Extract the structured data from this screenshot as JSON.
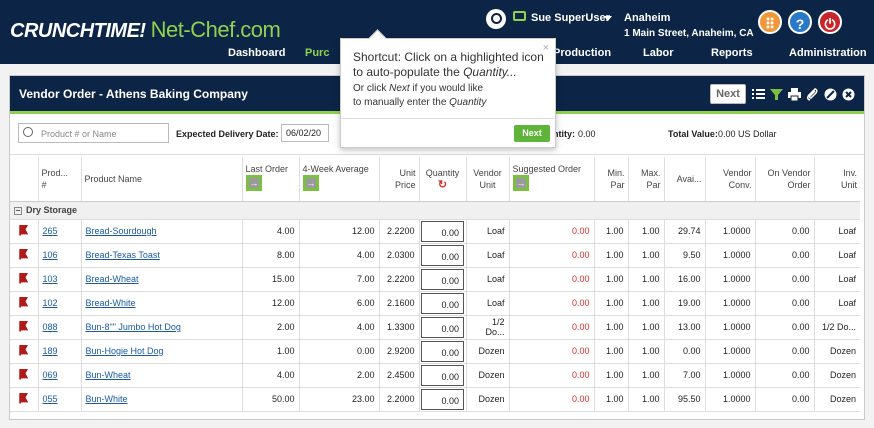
{
  "brand": {
    "part1": "CRUNCHTIME!",
    "part2": "Net-Chef.com"
  },
  "user": {
    "name": "Sue SuperUser"
  },
  "store": {
    "name": "Anaheim",
    "address": "1 Main Street, Anaheim, CA"
  },
  "nav": [
    {
      "label": "Dashboard"
    },
    {
      "label": "Purc"
    },
    {
      "label": "Production"
    },
    {
      "label": "Labor"
    },
    {
      "label": "Reports"
    },
    {
      "label": "Administration"
    }
  ],
  "panel": {
    "title": "Vendor Order - Athens Baking Company",
    "next_label": "Next"
  },
  "filters": {
    "search_placeholder": "Product # or Name",
    "delivery_label": "Expected Delivery Date:",
    "delivery_value": "06/02/20",
    "quantity_label": "antity:",
    "quantity_value": "0.00",
    "total_label": "Total Value:",
    "total_value": "0.00 US Dollar"
  },
  "tooltip": {
    "line1": "Shortcut: Click on a highlighted icon",
    "line2_pre": "to auto-populate the ",
    "line2_em": "Quantity...",
    "line3_pre": "Or click ",
    "line3_em": "Next",
    "line3_post": " if you would like",
    "line4_pre": "to manually enter the ",
    "line4_em": "Quantity",
    "button": "Next",
    "close": "×"
  },
  "columns": {
    "product_num": "Prod...\n#",
    "product_name": "Product Name",
    "last_order": "Last Order",
    "four_week": "4-Week Average",
    "unit_price": "Unit\nPrice",
    "quantity": "Quantity",
    "vendor_unit": "Vendor\nUnit",
    "suggested": "Suggested Order",
    "min_par": "Min.\nPar",
    "max_par": "Max.\nPar",
    "avail": "Avai...",
    "vendor_conv": "Vendor\nConv.",
    "on_vendor_order": "On Vendor\nOrder",
    "inv_unit": "Inv.\nUnit"
  },
  "group": {
    "label": "Dry Storage",
    "toggle": "−"
  },
  "rows": [
    {
      "num": "265",
      "name": "Bread-Sourdough",
      "last": "4.00",
      "avg": "12.00",
      "price": "2.2200",
      "qty": "0.00",
      "vunit": "Loaf",
      "sugg": "0.00",
      "min": "1.00",
      "max": "1.00",
      "avail": "29.74",
      "conv": "1.0000",
      "onorder": "0.00",
      "iunit": "Loaf"
    },
    {
      "num": "106",
      "name": "Bread-Texas Toast",
      "last": "8.00",
      "avg": "4.00",
      "price": "2.0300",
      "qty": "0.00",
      "vunit": "Loaf",
      "sugg": "0.00",
      "min": "1.00",
      "max": "1.00",
      "avail": "9.50",
      "conv": "1.0000",
      "onorder": "0.00",
      "iunit": "Loaf"
    },
    {
      "num": "103",
      "name": "Bread-Wheat",
      "last": "15.00",
      "avg": "7.00",
      "price": "2.2200",
      "qty": "0.00",
      "vunit": "Loaf",
      "sugg": "0.00",
      "min": "1.00",
      "max": "1.00",
      "avail": "16.00",
      "conv": "1.0000",
      "onorder": "0.00",
      "iunit": "Loaf"
    },
    {
      "num": "102",
      "name": "Bread-White",
      "last": "12.00",
      "avg": "6.00",
      "price": "2.1600",
      "qty": "0.00",
      "vunit": "Loaf",
      "sugg": "0.00",
      "min": "1.00",
      "max": "1.00",
      "avail": "19.00",
      "conv": "1.0000",
      "onorder": "0.00",
      "iunit": "Loaf"
    },
    {
      "num": "088",
      "name": "Bun-8\"\" Jumbo Hot Dog",
      "last": "2.00",
      "avg": "4.00",
      "price": "1.3300",
      "qty": "0.00",
      "vunit": "1/2 Do...",
      "sugg": "0.00",
      "min": "1.00",
      "max": "1.00",
      "avail": "13.00",
      "conv": "1.0000",
      "onorder": "0.00",
      "iunit": "1/2 Do..."
    },
    {
      "num": "189",
      "name": "Bun-Hogie Hot Dog",
      "last": "1.00",
      "avg": "0.00",
      "price": "2.9200",
      "qty": "0.00",
      "vunit": "Dozen",
      "sugg": "0.00",
      "min": "1.00",
      "max": "1.00",
      "avail": "0.00",
      "conv": "1.0000",
      "onorder": "0.00",
      "iunit": "Dozen"
    },
    {
      "num": "069",
      "name": "Bun-Wheat",
      "last": "4.00",
      "avg": "2.00",
      "price": "2.4500",
      "qty": "0.00",
      "vunit": "Dozen",
      "sugg": "0.00",
      "min": "1.00",
      "max": "1.00",
      "avail": "7.00",
      "conv": "1.0000",
      "onorder": "0.00",
      "iunit": "Dozen"
    },
    {
      "num": "055",
      "name": "Bun-White",
      "last": "50.00",
      "avg": "23.00",
      "price": "2.2000",
      "qty": "0.00",
      "vunit": "Dozen",
      "sugg": "0.00",
      "min": "1.00",
      "max": "1.00",
      "avail": "95.50",
      "conv": "1.0000",
      "onorder": "0.00",
      "iunit": "Dozen"
    }
  ],
  "icons": {
    "apps": "apps-grid-icon",
    "help": "help-icon",
    "logout": "logout-icon"
  },
  "colors": {
    "navy": "#0c2546",
    "accent_green": "#8fd14f",
    "link_blue": "#1a5aa0",
    "suggested_red": "#d0332f"
  }
}
